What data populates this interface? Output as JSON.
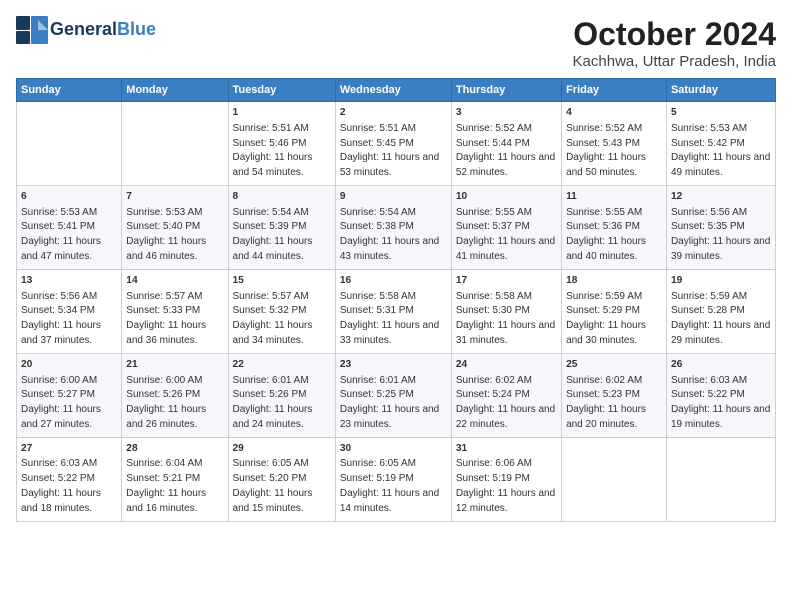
{
  "header": {
    "logo_general": "General",
    "logo_blue": "Blue",
    "title": "October 2024",
    "subtitle": "Kachhwa, Uttar Pradesh, India"
  },
  "calendar": {
    "days_of_week": [
      "Sunday",
      "Monday",
      "Tuesday",
      "Wednesday",
      "Thursday",
      "Friday",
      "Saturday"
    ],
    "weeks": [
      [
        {
          "day": "",
          "info": ""
        },
        {
          "day": "",
          "info": ""
        },
        {
          "day": "1",
          "info": "Sunrise: 5:51 AM\nSunset: 5:46 PM\nDaylight: 11 hours and 54 minutes."
        },
        {
          "day": "2",
          "info": "Sunrise: 5:51 AM\nSunset: 5:45 PM\nDaylight: 11 hours and 53 minutes."
        },
        {
          "day": "3",
          "info": "Sunrise: 5:52 AM\nSunset: 5:44 PM\nDaylight: 11 hours and 52 minutes."
        },
        {
          "day": "4",
          "info": "Sunrise: 5:52 AM\nSunset: 5:43 PM\nDaylight: 11 hours and 50 minutes."
        },
        {
          "day": "5",
          "info": "Sunrise: 5:53 AM\nSunset: 5:42 PM\nDaylight: 11 hours and 49 minutes."
        }
      ],
      [
        {
          "day": "6",
          "info": "Sunrise: 5:53 AM\nSunset: 5:41 PM\nDaylight: 11 hours and 47 minutes."
        },
        {
          "day": "7",
          "info": "Sunrise: 5:53 AM\nSunset: 5:40 PM\nDaylight: 11 hours and 46 minutes."
        },
        {
          "day": "8",
          "info": "Sunrise: 5:54 AM\nSunset: 5:39 PM\nDaylight: 11 hours and 44 minutes."
        },
        {
          "day": "9",
          "info": "Sunrise: 5:54 AM\nSunset: 5:38 PM\nDaylight: 11 hours and 43 minutes."
        },
        {
          "day": "10",
          "info": "Sunrise: 5:55 AM\nSunset: 5:37 PM\nDaylight: 11 hours and 41 minutes."
        },
        {
          "day": "11",
          "info": "Sunrise: 5:55 AM\nSunset: 5:36 PM\nDaylight: 11 hours and 40 minutes."
        },
        {
          "day": "12",
          "info": "Sunrise: 5:56 AM\nSunset: 5:35 PM\nDaylight: 11 hours and 39 minutes."
        }
      ],
      [
        {
          "day": "13",
          "info": "Sunrise: 5:56 AM\nSunset: 5:34 PM\nDaylight: 11 hours and 37 minutes."
        },
        {
          "day": "14",
          "info": "Sunrise: 5:57 AM\nSunset: 5:33 PM\nDaylight: 11 hours and 36 minutes."
        },
        {
          "day": "15",
          "info": "Sunrise: 5:57 AM\nSunset: 5:32 PM\nDaylight: 11 hours and 34 minutes."
        },
        {
          "day": "16",
          "info": "Sunrise: 5:58 AM\nSunset: 5:31 PM\nDaylight: 11 hours and 33 minutes."
        },
        {
          "day": "17",
          "info": "Sunrise: 5:58 AM\nSunset: 5:30 PM\nDaylight: 11 hours and 31 minutes."
        },
        {
          "day": "18",
          "info": "Sunrise: 5:59 AM\nSunset: 5:29 PM\nDaylight: 11 hours and 30 minutes."
        },
        {
          "day": "19",
          "info": "Sunrise: 5:59 AM\nSunset: 5:28 PM\nDaylight: 11 hours and 29 minutes."
        }
      ],
      [
        {
          "day": "20",
          "info": "Sunrise: 6:00 AM\nSunset: 5:27 PM\nDaylight: 11 hours and 27 minutes."
        },
        {
          "day": "21",
          "info": "Sunrise: 6:00 AM\nSunset: 5:26 PM\nDaylight: 11 hours and 26 minutes."
        },
        {
          "day": "22",
          "info": "Sunrise: 6:01 AM\nSunset: 5:26 PM\nDaylight: 11 hours and 24 minutes."
        },
        {
          "day": "23",
          "info": "Sunrise: 6:01 AM\nSunset: 5:25 PM\nDaylight: 11 hours and 23 minutes."
        },
        {
          "day": "24",
          "info": "Sunrise: 6:02 AM\nSunset: 5:24 PM\nDaylight: 11 hours and 22 minutes."
        },
        {
          "day": "25",
          "info": "Sunrise: 6:02 AM\nSunset: 5:23 PM\nDaylight: 11 hours and 20 minutes."
        },
        {
          "day": "26",
          "info": "Sunrise: 6:03 AM\nSunset: 5:22 PM\nDaylight: 11 hours and 19 minutes."
        }
      ],
      [
        {
          "day": "27",
          "info": "Sunrise: 6:03 AM\nSunset: 5:22 PM\nDaylight: 11 hours and 18 minutes."
        },
        {
          "day": "28",
          "info": "Sunrise: 6:04 AM\nSunset: 5:21 PM\nDaylight: 11 hours and 16 minutes."
        },
        {
          "day": "29",
          "info": "Sunrise: 6:05 AM\nSunset: 5:20 PM\nDaylight: 11 hours and 15 minutes."
        },
        {
          "day": "30",
          "info": "Sunrise: 6:05 AM\nSunset: 5:19 PM\nDaylight: 11 hours and 14 minutes."
        },
        {
          "day": "31",
          "info": "Sunrise: 6:06 AM\nSunset: 5:19 PM\nDaylight: 11 hours and 12 minutes."
        },
        {
          "day": "",
          "info": ""
        },
        {
          "day": "",
          "info": ""
        }
      ]
    ]
  }
}
